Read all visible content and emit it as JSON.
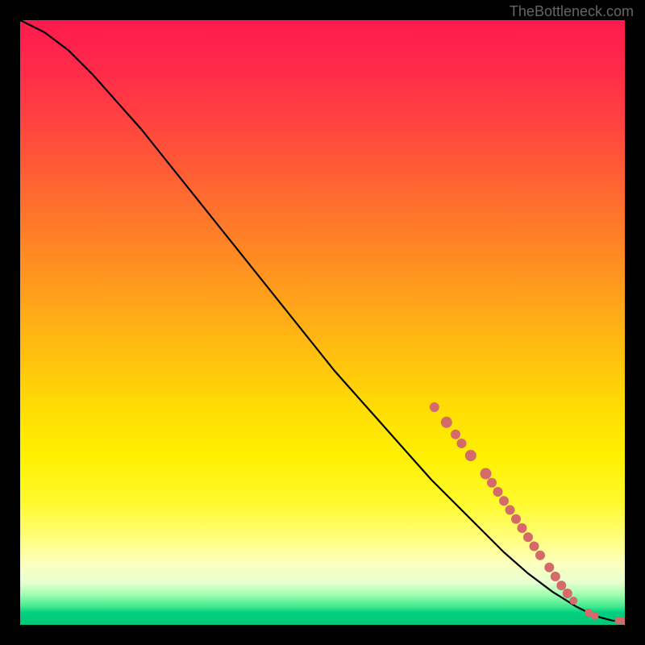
{
  "attribution": "TheBottleneck.com",
  "chart_data": {
    "type": "line",
    "title": "",
    "xlabel": "",
    "ylabel": "",
    "xlim": [
      0,
      100
    ],
    "ylim": [
      0,
      100
    ],
    "series": [
      {
        "name": "curve",
        "x": [
          0,
          4,
          8,
          12,
          16,
          20,
          24,
          28,
          32,
          36,
          40,
          44,
          48,
          52,
          56,
          60,
          64,
          68,
          72,
          76,
          80,
          84,
          88,
          92,
          94,
          96,
          98,
          100
        ],
        "y": [
          100,
          98,
          95,
          91,
          86.5,
          82,
          77,
          72,
          67,
          62,
          57,
          52,
          47,
          42,
          37.5,
          33,
          28.5,
          24,
          20,
          16,
          12,
          8.5,
          5.5,
          3,
          2,
          1.2,
          0.7,
          0.6
        ]
      }
    ],
    "markers": [
      {
        "x": 68.5,
        "y": 36.0,
        "r": 6
      },
      {
        "x": 70.5,
        "y": 33.5,
        "r": 7
      },
      {
        "x": 72.0,
        "y": 31.5,
        "r": 6
      },
      {
        "x": 73.0,
        "y": 30.0,
        "r": 6
      },
      {
        "x": 74.5,
        "y": 28.0,
        "r": 7
      },
      {
        "x": 77.0,
        "y": 25.0,
        "r": 7
      },
      {
        "x": 78.0,
        "y": 23.5,
        "r": 6
      },
      {
        "x": 79.0,
        "y": 22.0,
        "r": 6
      },
      {
        "x": 80.0,
        "y": 20.5,
        "r": 6
      },
      {
        "x": 81.0,
        "y": 19.0,
        "r": 6
      },
      {
        "x": 82.0,
        "y": 17.5,
        "r": 6
      },
      {
        "x": 83.0,
        "y": 16.0,
        "r": 6
      },
      {
        "x": 84.0,
        "y": 14.5,
        "r": 6
      },
      {
        "x": 85.0,
        "y": 13.0,
        "r": 6
      },
      {
        "x": 86.0,
        "y": 11.5,
        "r": 6
      },
      {
        "x": 87.5,
        "y": 9.5,
        "r": 6
      },
      {
        "x": 88.5,
        "y": 8.0,
        "r": 6
      },
      {
        "x": 89.5,
        "y": 6.5,
        "r": 6
      },
      {
        "x": 90.5,
        "y": 5.2,
        "r": 6
      },
      {
        "x": 91.5,
        "y": 4.0,
        "r": 5
      },
      {
        "x": 94.0,
        "y": 2.0,
        "r": 5
      },
      {
        "x": 95.0,
        "y": 1.5,
        "r": 5
      },
      {
        "x": 99.0,
        "y": 0.7,
        "r": 5
      },
      {
        "x": 100.0,
        "y": 0.6,
        "r": 5
      }
    ],
    "marker_color": "#d46a6a"
  }
}
